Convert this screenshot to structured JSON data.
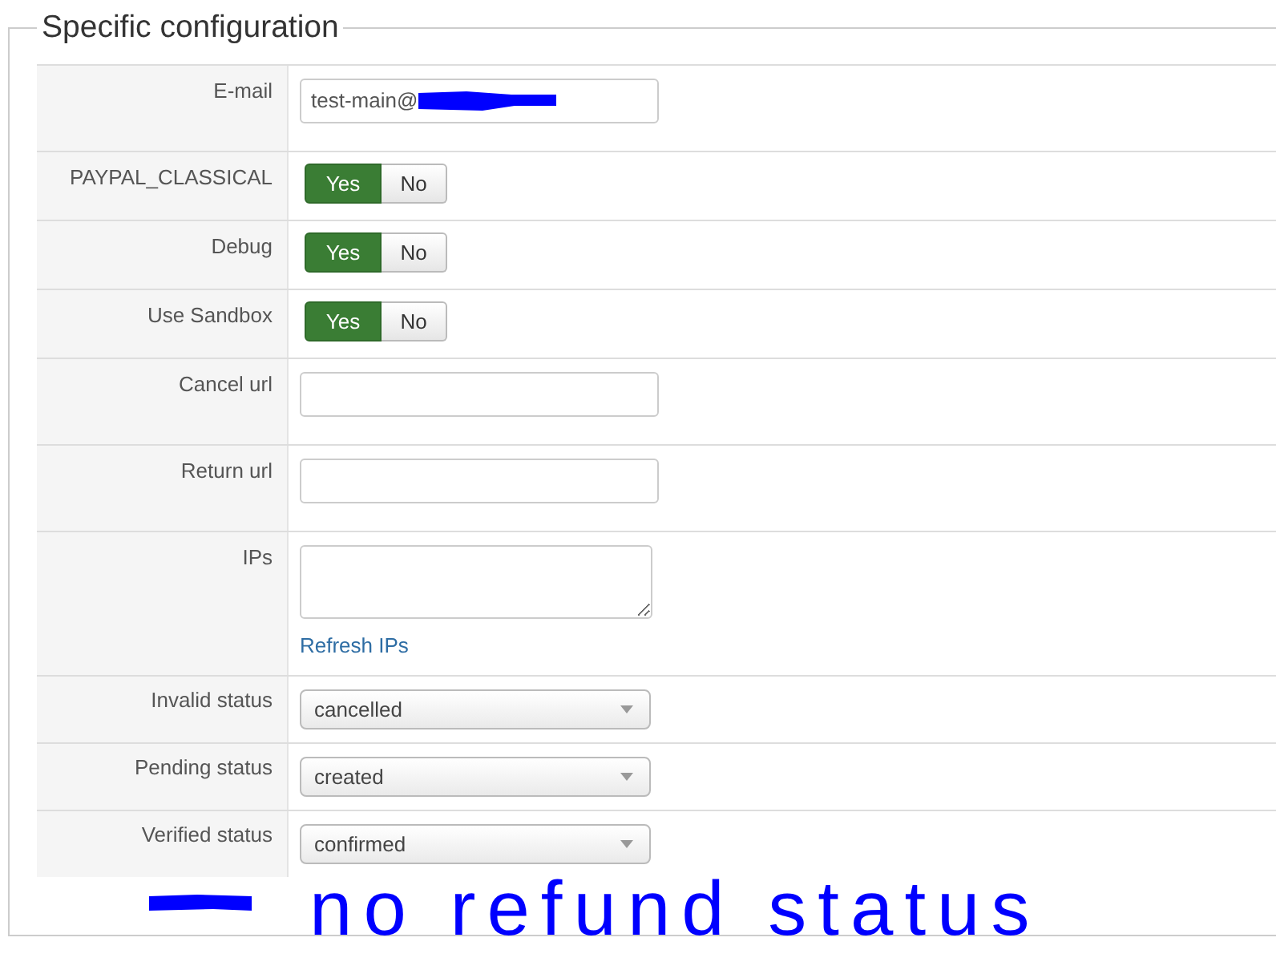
{
  "fieldset": {
    "legend": "Specific configuration"
  },
  "fields": [
    {
      "kind": "text",
      "label": "E-mail",
      "value": "test-main@",
      "redacted": true
    },
    {
      "kind": "toggle",
      "label": "PAYPAL_CLASSICAL",
      "options": [
        {
          "label": "Yes",
          "selected": true
        },
        {
          "label": "No",
          "selected": false
        }
      ]
    },
    {
      "kind": "toggle",
      "label": "Debug",
      "options": [
        {
          "label": "Yes",
          "selected": true
        },
        {
          "label": "No",
          "selected": false
        }
      ]
    },
    {
      "kind": "toggle",
      "label": "Use Sandbox",
      "options": [
        {
          "label": "Yes",
          "selected": true
        },
        {
          "label": "No",
          "selected": false
        }
      ]
    },
    {
      "kind": "text",
      "label": "Cancel url",
      "redacted": false
    },
    {
      "kind": "text",
      "label": "Return url",
      "redacted": false
    },
    {
      "kind": "textarea",
      "label": "IPs",
      "link": "Refresh IPs"
    },
    {
      "kind": "select",
      "label": "Invalid status",
      "value": "cancelled"
    },
    {
      "kind": "select",
      "label": "Pending status",
      "value": "created"
    },
    {
      "kind": "select",
      "label": "Verified status",
      "value": "confirmed"
    }
  ],
  "annotation": {
    "note": "no refund status"
  }
}
